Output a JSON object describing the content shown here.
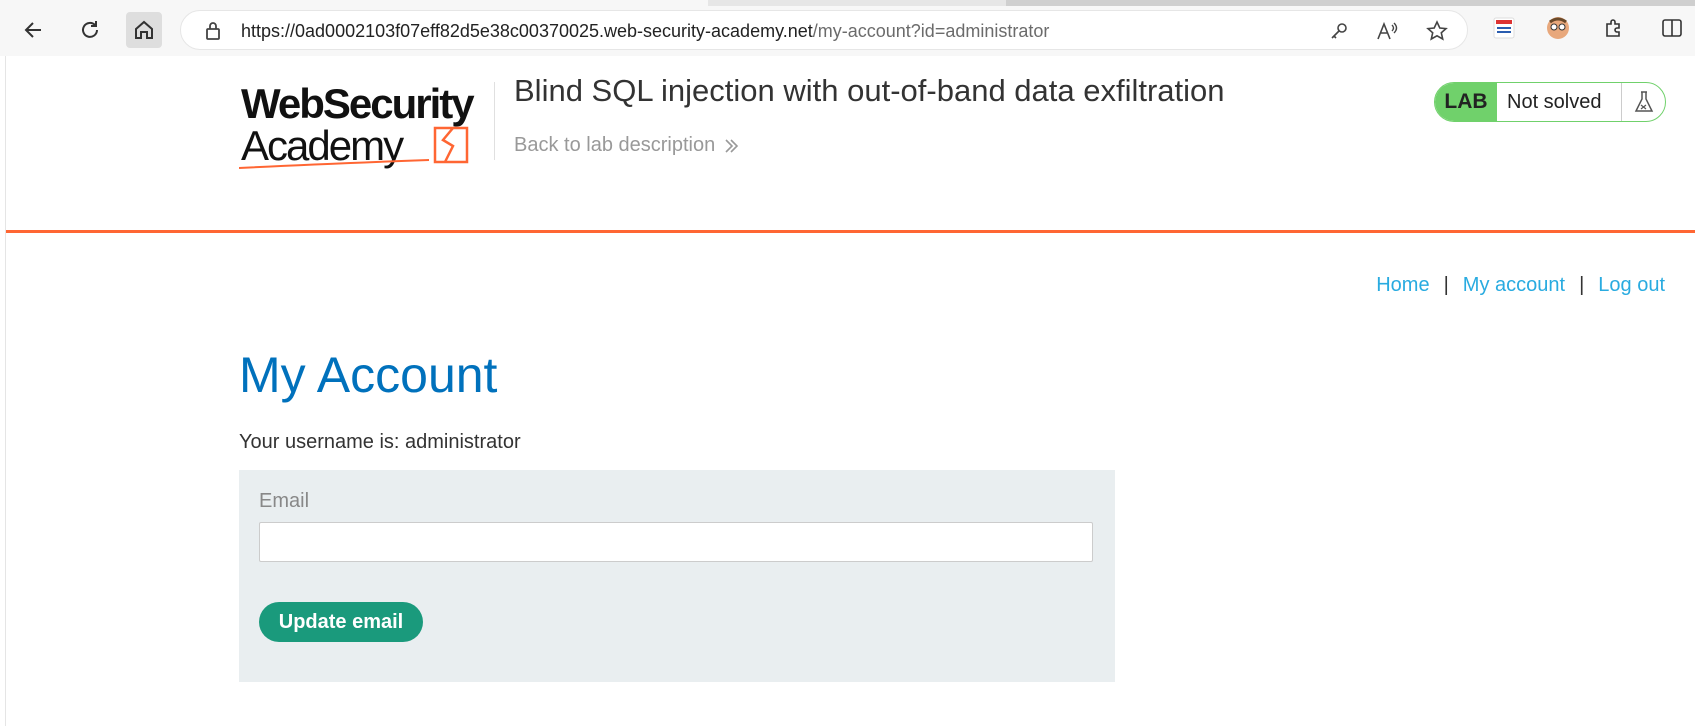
{
  "browser": {
    "url_host": "https://0ad0002103f07eff82d5e38c00370025.web-security-academy.net",
    "url_path": "/my-account?id=administrator"
  },
  "header": {
    "logo_line1": "WebSecurity",
    "logo_line2": "Academy",
    "lab_title": "Blind SQL injection with out-of-band data exfiltration",
    "back_link": "Back to lab description",
    "lab_badge_label": "LAB",
    "lab_status": "Not solved",
    "accent_color": "#ff6633",
    "status_color": "#70d16b"
  },
  "nav": {
    "home": "Home",
    "my_account": "My account",
    "log_out": "Log out",
    "separator": "|"
  },
  "main": {
    "heading": "My Account",
    "username_text": "Your username is: administrator",
    "email_label": "Email",
    "email_value": "",
    "update_button": "Update email"
  }
}
